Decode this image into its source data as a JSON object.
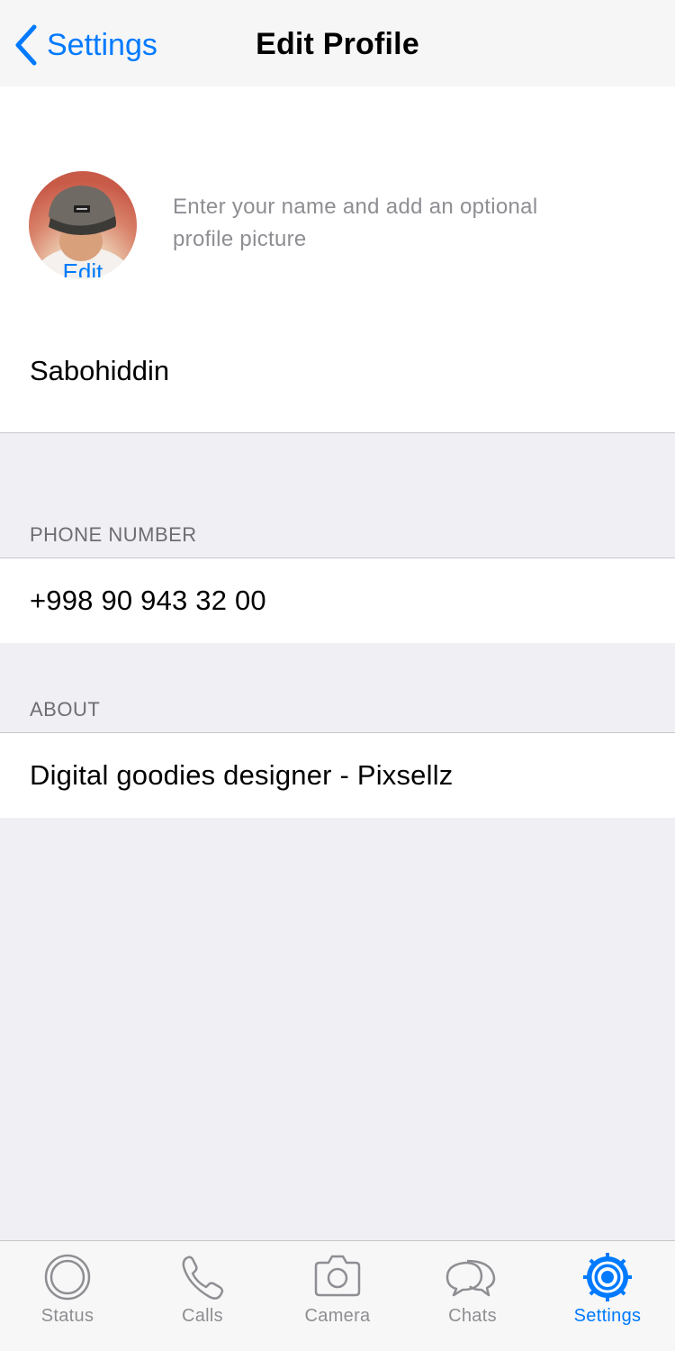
{
  "nav": {
    "back_label": "Settings",
    "title": "Edit Profile"
  },
  "profile": {
    "edit_label": "Edit",
    "hint": "Enter your name and add an optional profile picture",
    "name": "Sabohiddin"
  },
  "phone": {
    "header": "PHONE NUMBER",
    "value": "+998 90 943 32 00"
  },
  "about": {
    "header": "ABOUT",
    "value": "Digital goodies designer - Pixsellz"
  },
  "tabbar": {
    "tabs": [
      {
        "label": "Status",
        "icon": "status-icon"
      },
      {
        "label": "Calls",
        "icon": "phone-icon"
      },
      {
        "label": "Camera",
        "icon": "camera-icon"
      },
      {
        "label": "Chats",
        "icon": "chats-icon"
      },
      {
        "label": "Settings",
        "icon": "settings-gear-icon",
        "active": true
      }
    ]
  },
  "colors": {
    "accent": "#007aff",
    "inactive": "#8e8e93",
    "background": "#efeff4"
  }
}
